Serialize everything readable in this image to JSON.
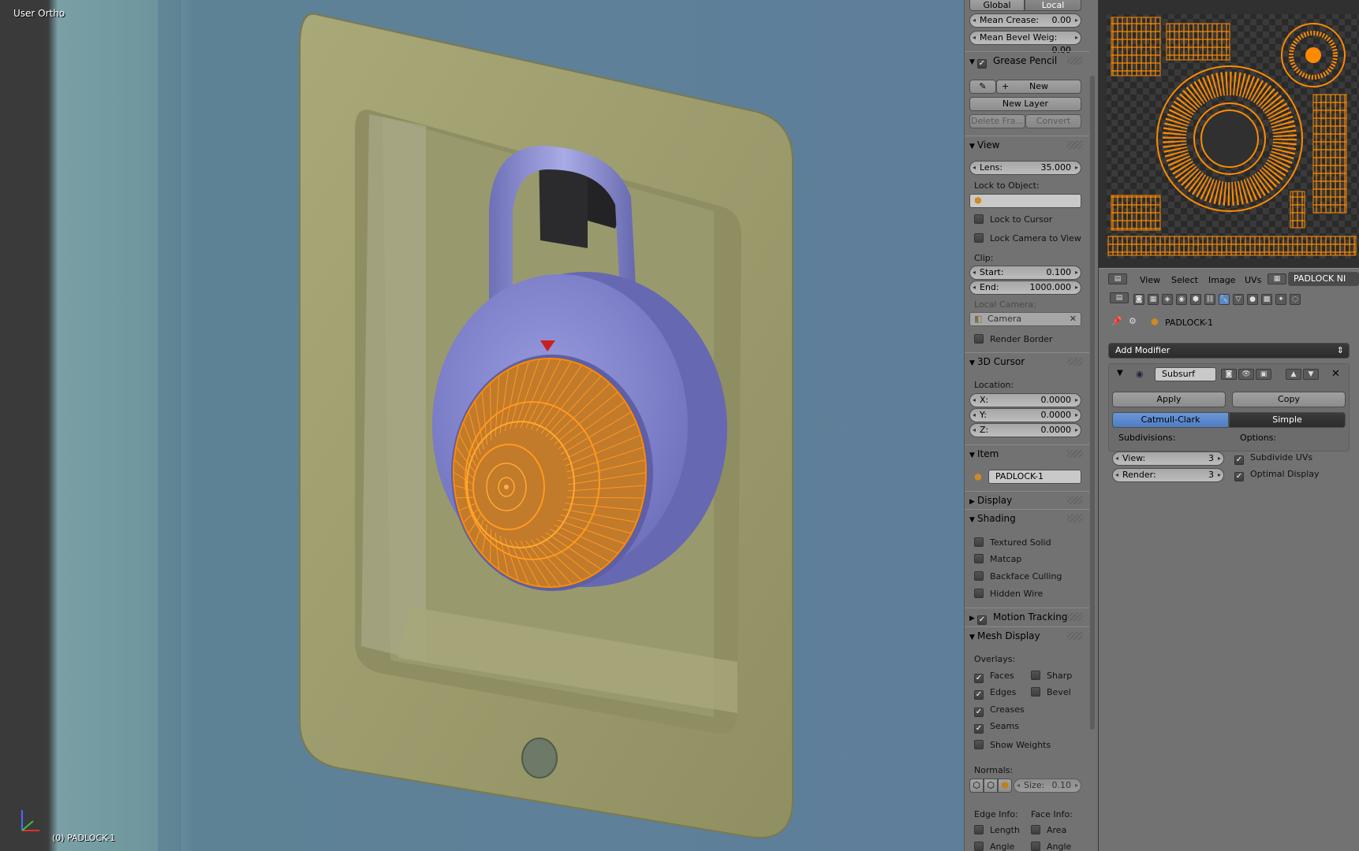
{
  "viewport": {
    "view_label": "User Ortho",
    "object_label": "(0) PADLOCK-1"
  },
  "npanel": {
    "orientation": {
      "global": "Global",
      "local": "Local"
    },
    "mean_crease": {
      "label": "Mean Crease:",
      "value": "0.00"
    },
    "mean_bevel": {
      "label": "Mean Bevel Weig:",
      "value": "0.00"
    },
    "grease_pencil": {
      "title": "Grease Pencil",
      "new": "New",
      "new_layer": "New Layer",
      "delete_frame": "Delete Fra...",
      "convert": "Convert"
    },
    "view": {
      "title": "View",
      "lens": {
        "label": "Lens:",
        "value": "35.000"
      },
      "lock_to_object": "Lock to Object:",
      "lock_to_cursor": "Lock to Cursor",
      "lock_camera": "Lock Camera to View",
      "clip": "Clip:",
      "start": {
        "label": "Start:",
        "value": "0.100"
      },
      "end": {
        "label": "End:",
        "value": "1000.000"
      },
      "local_camera": "Local Camera:",
      "camera": "Camera",
      "render_border": "Render Border"
    },
    "cursor": {
      "title": "3D Cursor",
      "location": "Location:",
      "x": {
        "label": "X:",
        "value": "0.0000"
      },
      "y": {
        "label": "Y:",
        "value": "0.0000"
      },
      "z": {
        "label": "Z:",
        "value": "0.0000"
      }
    },
    "item": {
      "title": "Item",
      "name": "PADLOCK-1"
    },
    "display": {
      "title": "Display"
    },
    "shading": {
      "title": "Shading",
      "textured_solid": "Textured Solid",
      "matcap": "Matcap",
      "backface": "Backface Culling",
      "hidden_wire": "Hidden Wire"
    },
    "motion_tracking": {
      "title": "Motion Tracking"
    },
    "mesh_display": {
      "title": "Mesh Display",
      "overlays": "Overlays:",
      "faces": "Faces",
      "sharp": "Sharp",
      "edges": "Edges",
      "bevel": "Bevel",
      "creases": "Creases",
      "seams": "Seams",
      "show_weights": "Show Weights",
      "normals": "Normals:",
      "size": {
        "label": "Size:",
        "value": "0.10"
      },
      "edge_info": "Edge Info:",
      "face_info": "Face Info:",
      "length": "Length",
      "area": "Area",
      "angle": "Angle",
      "angle2": "Angle"
    }
  },
  "uv_header": {
    "view": "View",
    "select": "Select",
    "image": "Image",
    "uvs": "UVs",
    "image_name": "PADLOCK NI"
  },
  "properties": {
    "object": "PADLOCK-1",
    "add_modifier": "Add Modifier",
    "modifier_name": "Subsurf",
    "apply": "Apply",
    "copy": "Copy",
    "catmull": "Catmull-Clark",
    "simple": "Simple",
    "subdivisions": "Subdivisions:",
    "options": "Options:",
    "view": {
      "label": "View:",
      "value": "3"
    },
    "render": {
      "label": "Render:",
      "value": "3"
    },
    "subdivide_uvs": "Subdivide UVs",
    "optimal_display": "Optimal Display"
  },
  "colors": {
    "accent": "#5b87c9",
    "wire": "#ff8a00",
    "panel": "#727272"
  }
}
